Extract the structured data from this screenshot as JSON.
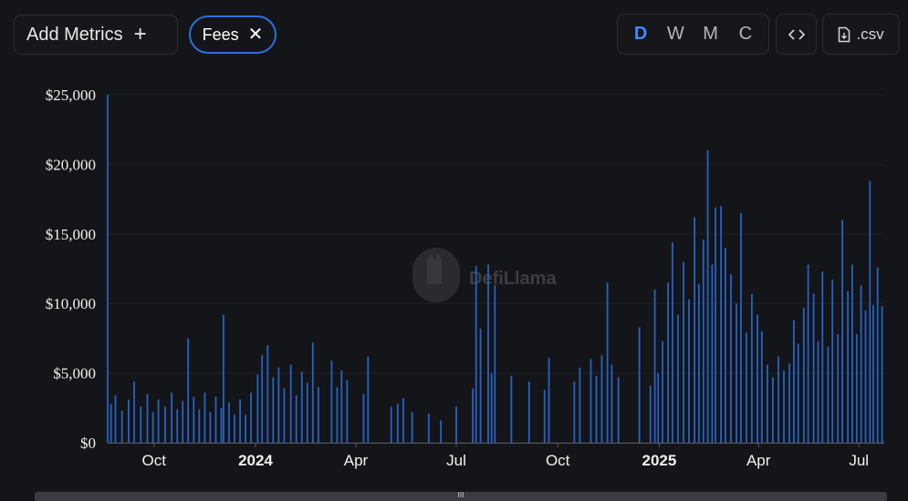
{
  "toolbar": {
    "add_metrics_label": "Add Metrics",
    "add_icon": "plus-icon",
    "metric_pill_label": "Fees",
    "remove_icon": "close-icon",
    "granularity": [
      "D",
      "W",
      "M",
      "C"
    ],
    "granularity_selected": "D",
    "embed_icon": "code-icon",
    "csv_label": ".csv",
    "csv_icon": "file-download-icon"
  },
  "watermark": {
    "text": "DefiLlama",
    "icon": "llama-logo"
  },
  "scrollbar_grip": "III",
  "colors": {
    "bar": "#2662c4",
    "accent": "#3f8cff",
    "background": "#141518"
  },
  "chart_data": {
    "type": "bar",
    "title": "",
    "xlabel": "",
    "ylabel": "",
    "ylim": [
      0,
      25000
    ],
    "yticks": [
      "$0",
      "$5,000",
      "$10,000",
      "$15,000",
      "$20,000",
      "$25,000"
    ],
    "xticks": [
      {
        "label": "Oct",
        "date": "2023-10-01",
        "bold": false
      },
      {
        "label": "2024",
        "date": "2024-01-01",
        "bold": true
      },
      {
        "label": "Apr",
        "date": "2024-04-01",
        "bold": false
      },
      {
        "label": "Jul",
        "date": "2024-07-01",
        "bold": false
      },
      {
        "label": "Oct",
        "date": "2024-10-01",
        "bold": false
      },
      {
        "label": "2025",
        "date": "2025-01-01",
        "bold": true
      },
      {
        "label": "Apr",
        "date": "2025-04-01",
        "bold": false
      },
      {
        "label": "Jul",
        "date": "2025-07-01",
        "bold": false
      }
    ],
    "x_range": [
      "2023-08-20",
      "2025-07-24"
    ],
    "grid": true,
    "series": [
      {
        "points": [
          [
            "2023-08-20",
            25000
          ],
          [
            "2023-08-23",
            2800
          ],
          [
            "2023-08-27",
            3400
          ],
          [
            "2023-09-02",
            2300
          ],
          [
            "2023-09-08",
            3100
          ],
          [
            "2023-09-13",
            4400
          ],
          [
            "2023-09-19",
            2600
          ],
          [
            "2023-09-25",
            3500
          ],
          [
            "2023-09-30",
            2200
          ],
          [
            "2023-10-05",
            3100
          ],
          [
            "2023-10-11",
            2600
          ],
          [
            "2023-10-17",
            3600
          ],
          [
            "2023-10-22",
            2400
          ],
          [
            "2023-10-27",
            3000
          ],
          [
            "2023-11-01",
            7500
          ],
          [
            "2023-11-06",
            3300
          ],
          [
            "2023-11-11",
            2400
          ],
          [
            "2023-11-16",
            3600
          ],
          [
            "2023-11-21",
            2200
          ],
          [
            "2023-11-26",
            3300
          ],
          [
            "2023-12-01",
            2500
          ],
          [
            "2023-12-03",
            9200
          ],
          [
            "2023-12-08",
            2900
          ],
          [
            "2023-12-13",
            2000
          ],
          [
            "2023-12-18",
            3100
          ],
          [
            "2023-12-23",
            2000
          ],
          [
            "2023-12-28",
            3600
          ],
          [
            "2024-01-03",
            4900
          ],
          [
            "2024-01-07",
            6300
          ],
          [
            "2024-01-12",
            7000
          ],
          [
            "2024-01-17",
            4700
          ],
          [
            "2024-01-22",
            5400
          ],
          [
            "2024-01-27",
            3900
          ],
          [
            "2024-02-02",
            5600
          ],
          [
            "2024-02-07",
            3400
          ],
          [
            "2024-02-12",
            5100
          ],
          [
            "2024-02-17",
            4300
          ],
          [
            "2024-02-22",
            7200
          ],
          [
            "2024-02-27",
            4000
          ],
          [
            "2024-03-10",
            5900
          ],
          [
            "2024-03-15",
            4000
          ],
          [
            "2024-03-19",
            5200
          ],
          [
            "2024-03-24",
            4500
          ],
          [
            "2024-04-08",
            3500
          ],
          [
            "2024-04-12",
            6200
          ],
          [
            "2024-05-03",
            2600
          ],
          [
            "2024-05-09",
            2800
          ],
          [
            "2024-05-14",
            3200
          ],
          [
            "2024-05-22",
            2200
          ],
          [
            "2024-06-06",
            2100
          ],
          [
            "2024-06-17",
            1600
          ],
          [
            "2024-07-01",
            2600
          ],
          [
            "2024-07-16",
            3900
          ],
          [
            "2024-07-19",
            12700
          ],
          [
            "2024-07-23",
            8200
          ],
          [
            "2024-07-30",
            12800
          ],
          [
            "2024-08-02",
            5000
          ],
          [
            "2024-08-05",
            11300
          ],
          [
            "2024-08-20",
            4800
          ],
          [
            "2024-09-05",
            4400
          ],
          [
            "2024-09-19",
            3800
          ],
          [
            "2024-09-23",
            6100
          ],
          [
            "2024-10-16",
            4400
          ],
          [
            "2024-10-21",
            5400
          ],
          [
            "2024-10-31",
            6000
          ],
          [
            "2024-11-05",
            4800
          ],
          [
            "2024-11-10",
            6300
          ],
          [
            "2024-11-15",
            11500
          ],
          [
            "2024-11-19",
            5600
          ],
          [
            "2024-11-25",
            4700
          ],
          [
            "2024-12-14",
            8300
          ],
          [
            "2024-12-24",
            4100
          ],
          [
            "2024-12-28",
            11000
          ],
          [
            "2024-12-31",
            5000
          ],
          [
            "2025-01-04",
            7300
          ],
          [
            "2025-01-09",
            11500
          ],
          [
            "2025-01-13",
            14400
          ],
          [
            "2025-01-18",
            9200
          ],
          [
            "2025-01-23",
            13000
          ],
          [
            "2025-01-28",
            10300
          ],
          [
            "2025-02-02",
            16200
          ],
          [
            "2025-02-06",
            11400
          ],
          [
            "2025-02-10",
            14600
          ],
          [
            "2025-02-14",
            21000
          ],
          [
            "2025-02-18",
            12800
          ],
          [
            "2025-02-21",
            16900
          ],
          [
            "2025-02-26",
            17000
          ],
          [
            "2025-03-02",
            14000
          ],
          [
            "2025-03-07",
            12100
          ],
          [
            "2025-03-12",
            10000
          ],
          [
            "2025-03-16",
            16500
          ],
          [
            "2025-03-21",
            7900
          ],
          [
            "2025-03-26",
            10700
          ],
          [
            "2025-03-31",
            9200
          ],
          [
            "2025-04-04",
            8000
          ],
          [
            "2025-04-09",
            5600
          ],
          [
            "2025-04-14",
            4700
          ],
          [
            "2025-04-19",
            6200
          ],
          [
            "2025-04-24",
            5200
          ],
          [
            "2025-04-29",
            5700
          ],
          [
            "2025-05-03",
            8800
          ],
          [
            "2025-05-07",
            7100
          ],
          [
            "2025-05-12",
            9700
          ],
          [
            "2025-05-16",
            12800
          ],
          [
            "2025-05-21",
            10700
          ],
          [
            "2025-05-25",
            7300
          ],
          [
            "2025-05-29",
            12300
          ],
          [
            "2025-06-03",
            6900
          ],
          [
            "2025-06-07",
            11700
          ],
          [
            "2025-06-12",
            7800
          ],
          [
            "2025-06-16",
            16000
          ],
          [
            "2025-06-21",
            10900
          ],
          [
            "2025-06-25",
            12800
          ],
          [
            "2025-06-29",
            7800
          ],
          [
            "2025-07-03",
            11300
          ],
          [
            "2025-07-07",
            9500
          ],
          [
            "2025-07-11",
            18800
          ],
          [
            "2025-07-14",
            9900
          ],
          [
            "2025-07-18",
            12600
          ],
          [
            "2025-07-22",
            9800
          ]
        ]
      }
    ]
  }
}
